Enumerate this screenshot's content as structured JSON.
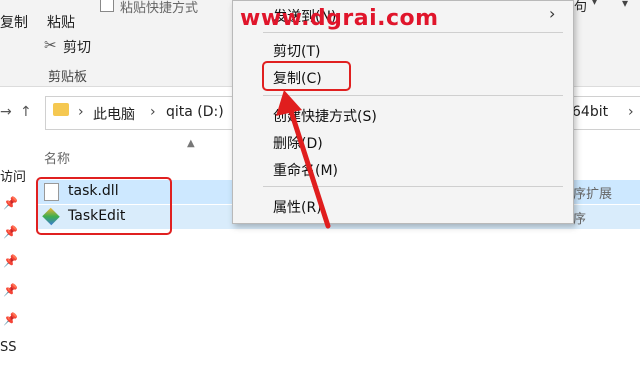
{
  "ribbon": {
    "copy_left": "复制",
    "paste": "粘贴",
    "paste_shortcut": "粘贴快捷方式",
    "cut": "剪切",
    "clipboard_group": "剪贴板",
    "top_right": "句"
  },
  "address": {
    "crumb1": "此电脑",
    "crumb2": "qita (D:)",
    "crumb_right": "64bit"
  },
  "columns": {
    "name": "名称"
  },
  "nav": {
    "quick_access": "访问",
    "bottom": "SS"
  },
  "files": [
    {
      "name": "task.dll",
      "type": "序扩展"
    },
    {
      "name": "TaskEdit",
      "type": "序"
    }
  ],
  "context_menu": {
    "items": [
      {
        "label": "发送到(N)"
      },
      {
        "label": "剪切(T)"
      },
      {
        "label": "复制(C)"
      },
      {
        "label": "创建快捷方式(S)"
      },
      {
        "label": "删除(D)"
      },
      {
        "label": "重命名(M)"
      },
      {
        "label": "属性(R)"
      }
    ]
  },
  "watermark": "www.dgrai.com",
  "colors": {
    "highlight_red": "#e02020",
    "selection_blue": "#cde8ff",
    "watermark_red": "#e0152b"
  }
}
